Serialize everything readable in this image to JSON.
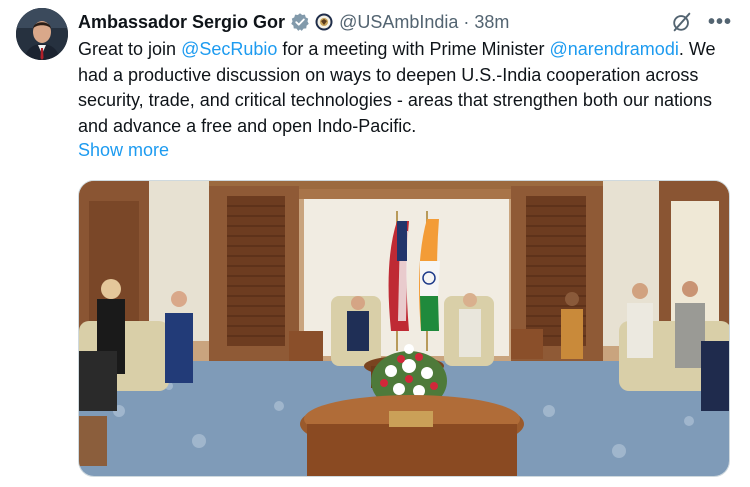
{
  "tweet": {
    "author_name": "Ambassador Sergio Gor",
    "handle": "@USAmbIndia",
    "separator": "·",
    "time": "38m",
    "text": {
      "part1": "Great to join ",
      "mention1": "@SecRubio",
      "part2": " for a meeting with Prime Minister ",
      "mention2": "@narendramodi",
      "part3": ". We had a productive discussion on ways to deepen U.S.-India cooperation across security, trade, and critical technologies - areas that strengthen both our nations and advance a free and open Indo-Pacific."
    },
    "show_more": "Show more",
    "more_menu": "•••"
  },
  "icons": {
    "verified": "verified-badge-icon",
    "affiliation": "state-department-seal-icon",
    "grok": "grok-icon",
    "more": "more-icon"
  },
  "colors": {
    "link": "#1d9bf0",
    "muted": "#536471",
    "verified_badge": "#829aab"
  }
}
